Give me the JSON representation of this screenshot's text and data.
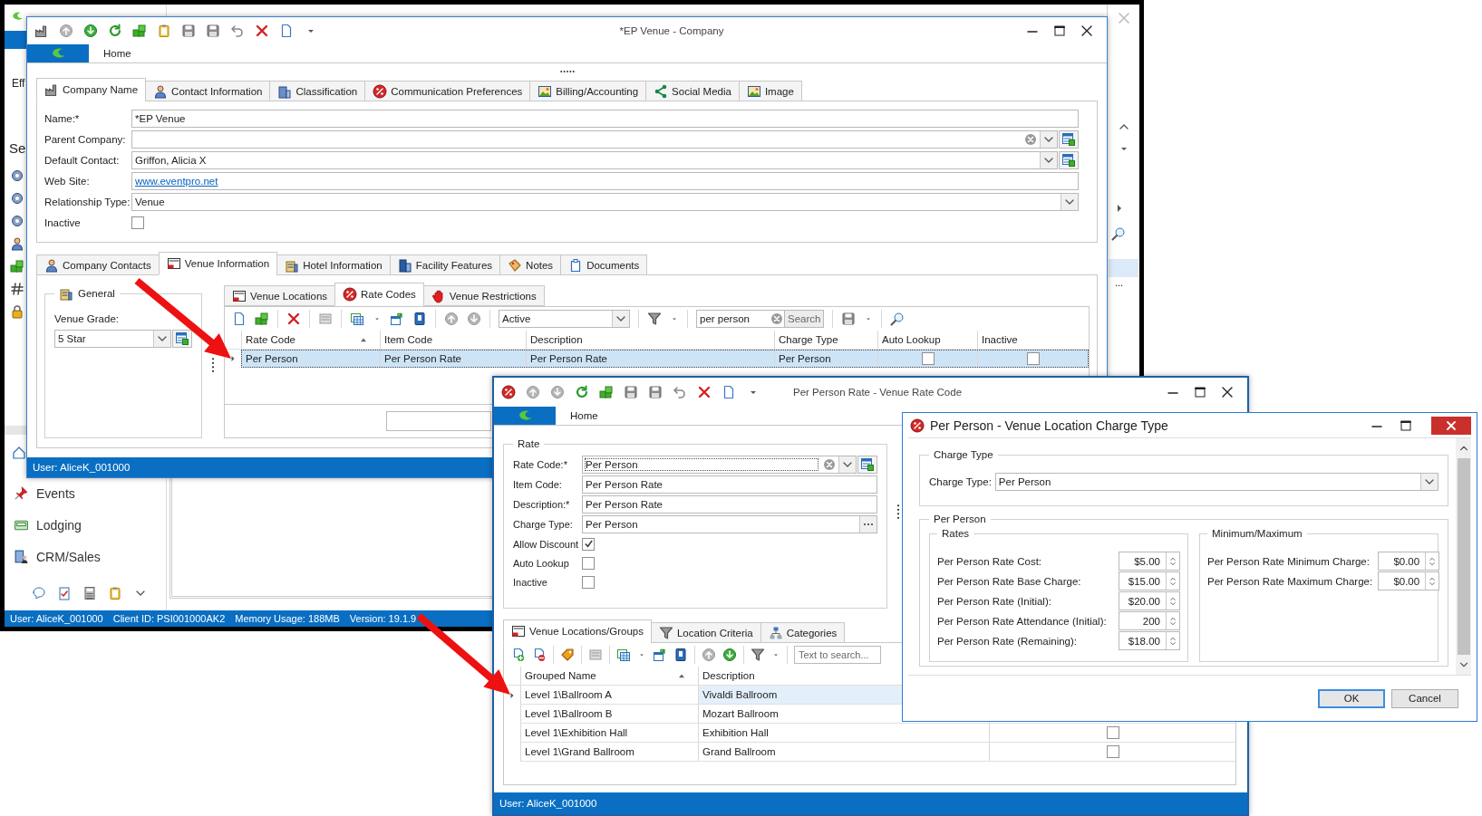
{
  "app": {
    "cut_labels": [
      "Eff",
      "Se"
    ],
    "right_cell": "...",
    "nav_items": [
      "Events",
      "Lodging",
      "CRM/Sales"
    ],
    "status": [
      "User: AliceK_001000",
      "Client ID: PSI001000AK2",
      "Memory Usage: 188MB",
      "Version: 19.1.9"
    ]
  },
  "company_window": {
    "title": "*EP Venue - Company",
    "ribbon_tab": "Home",
    "tabs": [
      {
        "label": "Company Name",
        "selected": true
      },
      {
        "label": "Contact Information",
        "selected": false
      },
      {
        "label": "Classification",
        "selected": false
      },
      {
        "label": "Communication Preferences",
        "selected": false
      },
      {
        "label": "Billing/Accounting",
        "selected": false
      },
      {
        "label": "Social Media",
        "selected": false
      },
      {
        "label": "Image",
        "selected": false
      }
    ],
    "fields": [
      {
        "label": "Name:*",
        "value": "*EP Venue",
        "kind": "text"
      },
      {
        "label": "Parent Company:",
        "kind": "lookup_clear"
      },
      {
        "label": "Default Contact:",
        "value": "Griffon, Alicia X",
        "kind": "lookup"
      },
      {
        "label": "Web Site:",
        "value": "www.eventpro.net",
        "kind": "link"
      },
      {
        "label": "Relationship Type:",
        "value": "Venue",
        "kind": "select"
      },
      {
        "label": "Inactive",
        "kind": "checkbox",
        "checked": false
      }
    ],
    "detail_tabs": [
      {
        "label": "Company Contacts",
        "selected": false
      },
      {
        "label": "Venue Information",
        "selected": true
      },
      {
        "label": "Hotel Information",
        "selected": false
      },
      {
        "label": "Facility Features",
        "selected": false
      },
      {
        "label": "Notes",
        "selected": false
      },
      {
        "label": "Documents",
        "selected": false
      }
    ],
    "general": {
      "title": "General",
      "label": "Venue Grade:",
      "value": "5 Star"
    },
    "venue_tabs": [
      {
        "label": "Venue Locations",
        "selected": false
      },
      {
        "label": "Rate Codes",
        "selected": true
      },
      {
        "label": "Venue Restrictions",
        "selected": false
      }
    ],
    "status_filter": "Active",
    "search": {
      "value": "per person",
      "button": "Search"
    },
    "columns": [
      {
        "label": "Rate Code",
        "sorted": true
      },
      {
        "label": "Item Code",
        "sorted": false
      },
      {
        "label": "Description",
        "sorted": false
      },
      {
        "label": "Charge Type",
        "sorted": false
      },
      {
        "label": "Auto Lookup",
        "sorted": false
      },
      {
        "label": "Inactive",
        "sorted": false
      }
    ],
    "rows": [
      {
        "rate_code": "Per Person",
        "item_code": "Per Person Rate",
        "description": "Per Person Rate",
        "charge_type": "Per Person",
        "auto_lookup": false,
        "inactive": false,
        "selected": true
      }
    ],
    "status": "User: AliceK_001000"
  },
  "rate_window": {
    "title": "Per Person Rate - Venue Rate Code",
    "ribbon_tab": "Home",
    "group": "Rate",
    "fields": [
      {
        "label": "Rate Code:*",
        "value": "Per Person",
        "kind": "lookup_clear"
      },
      {
        "label": "Item Code:",
        "value": "Per Person Rate",
        "kind": "text"
      },
      {
        "label": "Description:*",
        "value": "Per Person Rate",
        "kind": "text"
      },
      {
        "label": "Charge Type:",
        "value": "Per Person",
        "kind": "ellipsis"
      },
      {
        "label": "Allow Discount",
        "kind": "checkbox",
        "checked": true
      },
      {
        "label": "Auto Lookup",
        "kind": "checkbox",
        "checked": false
      },
      {
        "label": "Inactive",
        "kind": "checkbox",
        "checked": false
      }
    ],
    "tabs": [
      {
        "label": "Venue Locations/Groups",
        "selected": true
      },
      {
        "label": "Location Criteria",
        "selected": false
      },
      {
        "label": "Categories",
        "selected": false
      }
    ],
    "search_placeholder": "Text to search...",
    "columns": [
      {
        "label": "Grouped Name",
        "sorted": true
      },
      {
        "label": "Description"
      }
    ],
    "rows": [
      {
        "grouped_name": "Level 1\\Ballroom A",
        "description": "Vivaldi Ballroom",
        "selected": true
      },
      {
        "grouped_name": "Level 1\\Ballroom B",
        "description": "Mozart Ballroom",
        "selected": false
      },
      {
        "grouped_name": "Level 1\\Exhibition Hall",
        "description": "Exhibition Hall",
        "selected": false,
        "checked": false
      },
      {
        "grouped_name": "Level 1\\Grand Ballroom",
        "description": "Grand Ballroom",
        "selected": false,
        "checked": false
      }
    ],
    "status": "User: AliceK_001000"
  },
  "dialog": {
    "title": "Per Person - Venue Location Charge Type",
    "charge_group": "Charge Type",
    "charge_label": "Charge Type:",
    "charge_value": "Per Person",
    "per_person_group": "Per Person",
    "rates_group": "Rates",
    "rates": [
      {
        "label": "Per Person Rate Cost:",
        "value": "$5.00"
      },
      {
        "label": "Per Person Rate Base Charge:",
        "value": "$15.00"
      },
      {
        "label": "Per Person Rate (Initial):",
        "value": "$20.00"
      },
      {
        "label": "Per Person Rate Attendance (Initial):",
        "value": "200"
      },
      {
        "label": "Per Person Rate (Remaining):",
        "value": "$18.00"
      }
    ],
    "minmax_group": "Minimum/Maximum",
    "minmax": [
      {
        "label": "Per Person Rate Minimum Charge:",
        "value": "$0.00"
      },
      {
        "label": "Per Person Rate Maximum Charge:",
        "value": "$0.00"
      }
    ],
    "buttons": [
      {
        "label": "OK",
        "default": true
      },
      {
        "label": "Cancel",
        "default": false
      }
    ]
  }
}
